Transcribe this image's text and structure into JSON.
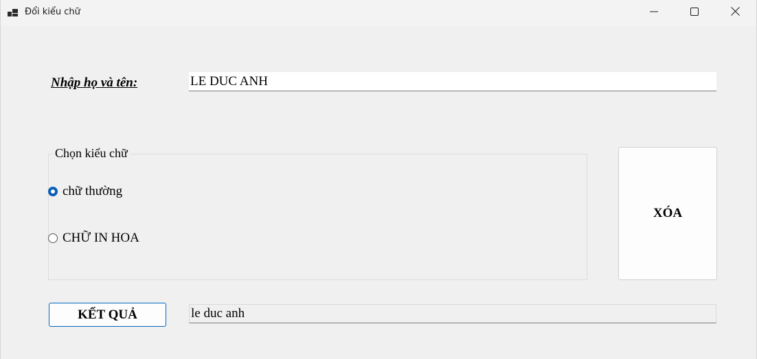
{
  "window": {
    "title": "Đổi kiểu chữ",
    "icon": "app-window-icon"
  },
  "form": {
    "name_label": "Nhập họ và tên:",
    "name_value": "LE DUC ANH",
    "group_title": "Chọn kiểu chữ",
    "options": [
      {
        "label": "chữ thường",
        "checked": true
      },
      {
        "label": "CHỮ IN HOA",
        "checked": false
      }
    ],
    "clear_button": "XÓA",
    "result_button": "KẾT QUẢ",
    "result_value": "le duc anh"
  },
  "colors": {
    "accent": "#0a5fb4",
    "background": "#f0f0f0"
  }
}
